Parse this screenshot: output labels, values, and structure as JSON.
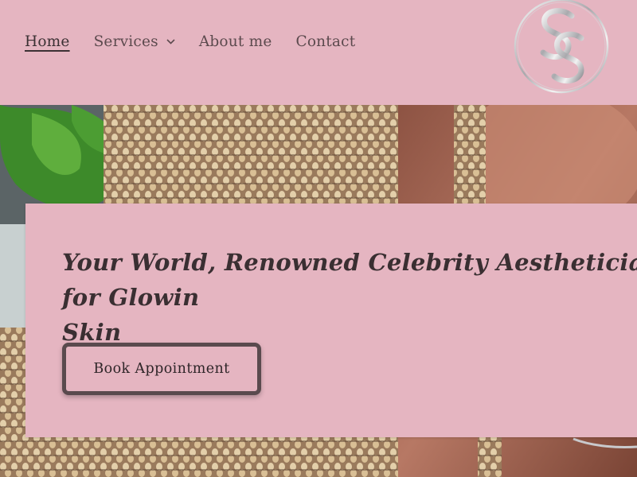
{
  "nav": {
    "items": [
      {
        "label": "Home",
        "active": true
      },
      {
        "label": "Services",
        "has_dropdown": true
      },
      {
        "label": "About me"
      },
      {
        "label": "Contact"
      }
    ]
  },
  "logo": {
    "monogram": "SS"
  },
  "hero": {
    "headline_regular": "Your World, Renowned Celebrity Aesthetician for ",
    "headline_bold_1": "Glowin",
    "headline_bold_2": "Skin",
    "cta_label": "Book Appointment"
  },
  "colors": {
    "background": "#e5b5c1",
    "text": "#3a2f32",
    "button_border": "#5a4a4e"
  }
}
